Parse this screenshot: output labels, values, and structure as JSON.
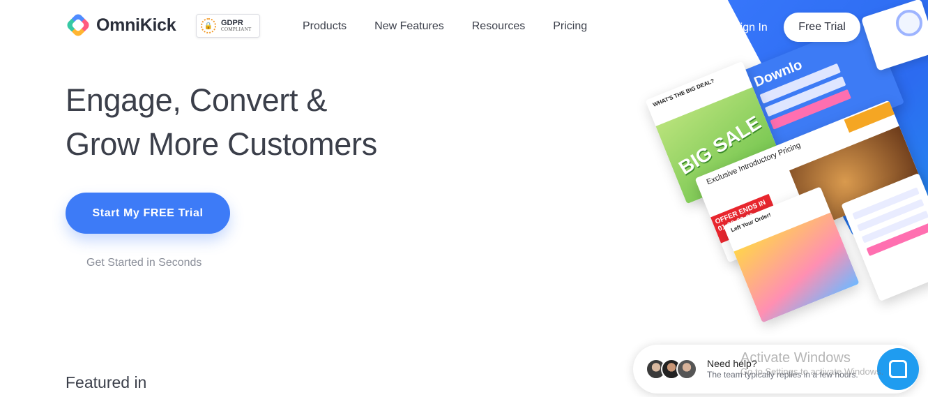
{
  "brand": {
    "name": "OmniKick"
  },
  "gdpr": {
    "title": "GDPR",
    "subtitle": "COMPLIANT"
  },
  "nav": {
    "items": [
      "Products",
      "New Features",
      "Resources",
      "Pricing"
    ]
  },
  "header": {
    "sign_in": "Sign In",
    "free_trial": "Free Trial"
  },
  "hero": {
    "title_line1": "Engage, Convert &",
    "title_line2": "Grow More Customers",
    "cta_label": "Start My FREE Trial",
    "cta_sub": "Get Started in Seconds"
  },
  "hero_art": {
    "bigsale_heading": "WHAT'S THE BIG DEAL?",
    "bigsale_text": "BIG SALE",
    "download_title": "Downlo",
    "pricing_heading": "Exclusive Introductory Pricing",
    "pricing_offer": "OFFER ENDS IN 01:02:09:00",
    "leftorder_heading": "Left Your Order!"
  },
  "featured": {
    "label": "Featured in"
  },
  "chat": {
    "title": "Need help?",
    "subtitle": "The team typically replies in a few hours."
  },
  "watermark": {
    "title": "Activate Windows",
    "subtitle": "Go to Settings to activate Windows."
  },
  "colors": {
    "primary": "#3d7bf7",
    "text": "#3b3f4a",
    "muted": "#8a8e99",
    "chat_launcher": "#1f9cf0"
  }
}
